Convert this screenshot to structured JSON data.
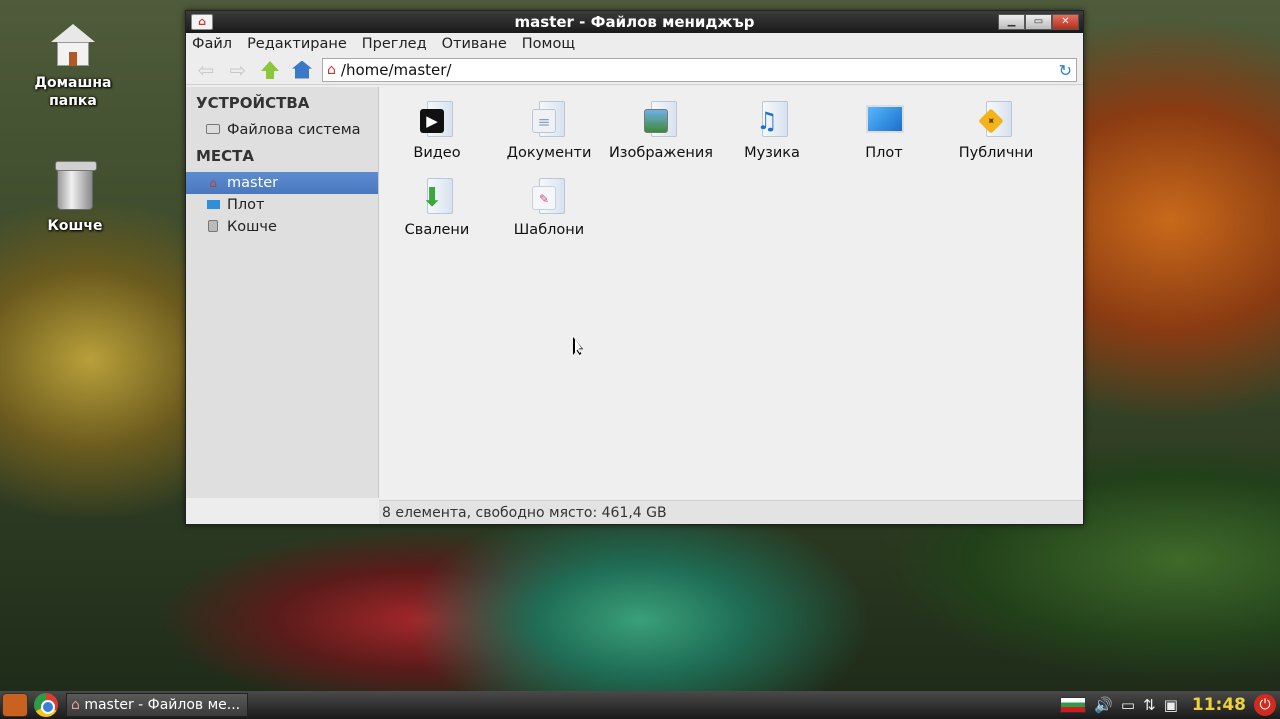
{
  "desktop": {
    "icons": [
      {
        "label": "Домашна папка"
      },
      {
        "label": "Кошче"
      }
    ]
  },
  "window": {
    "title": "master - Файлов мениджър",
    "menu": [
      "Файл",
      "Редактиране",
      "Преглед",
      "Отиване",
      "Помощ"
    ],
    "path": "/home/master/",
    "sidebar": {
      "devices_header": "УСТРОЙСТВА",
      "devices": [
        {
          "label": "Файлова система"
        }
      ],
      "places_header": "МЕСТА",
      "places": [
        {
          "label": "master",
          "active": true
        },
        {
          "label": "Плот"
        },
        {
          "label": "Кошче"
        }
      ]
    },
    "files": [
      {
        "label": "Видео"
      },
      {
        "label": "Документи"
      },
      {
        "label": "Изображения"
      },
      {
        "label": "Музика"
      },
      {
        "label": "Плот"
      },
      {
        "label": "Публични"
      },
      {
        "label": "Свалени"
      },
      {
        "label": "Шаблони"
      }
    ],
    "status": "8 елемента, свободно място: 461,4 GB"
  },
  "taskbar": {
    "task_label": "master - Файлов ме...",
    "clock": "11:48"
  }
}
